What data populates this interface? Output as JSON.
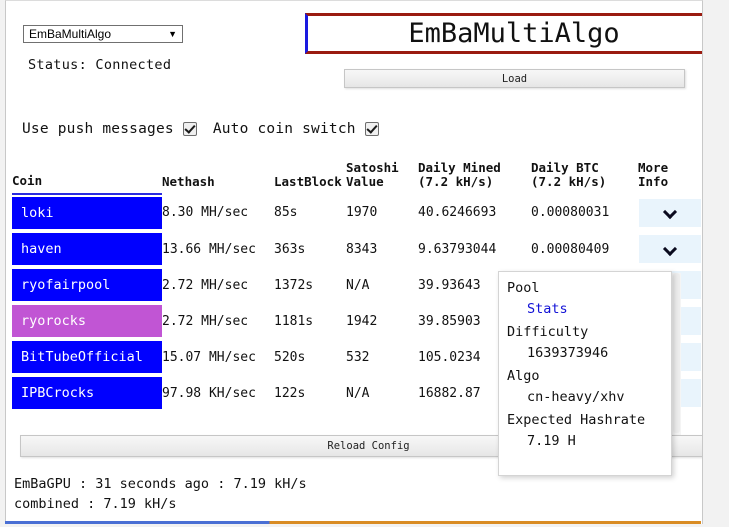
{
  "window": {
    "profile_select": {
      "value": "EmBaMultiAlgo",
      "caret": "▼"
    },
    "status": "Status: Connected",
    "title": "EmBaMultiAlgo",
    "load_button": "Load",
    "reload_button": "Reload Config"
  },
  "options": {
    "push_messages_label": "Use push messages",
    "push_messages_checked": true,
    "auto_switch_label": "Auto coin switch",
    "auto_switch_checked": true
  },
  "table": {
    "headers": {
      "coin": "Coin",
      "nethash": "Nethash",
      "lastblock": "LastBlock",
      "satoshi": "Satoshi\nValue",
      "daily_mined": "Daily Mined\n(7.2 kH/s)",
      "daily_btc": "Daily BTC\n(7.2 kH/s)",
      "more_info": "More Info"
    },
    "rows": [
      {
        "coin": "loki",
        "color": "#0000ff",
        "nethash": "8.30 MH/sec",
        "lastblock": "85s",
        "satoshi": "1970",
        "daily_mined": "40.6246693",
        "daily_btc": "0.00080031",
        "more_icon": "chevron-down-icon"
      },
      {
        "coin": "haven",
        "color": "#0000ff",
        "nethash": "13.66 MH/sec",
        "lastblock": "363s",
        "satoshi": "8343",
        "daily_mined": "9.63793044",
        "daily_btc": "0.00080409",
        "more_icon": "chevron-down-icon"
      },
      {
        "coin": "ryofairpool",
        "color": "#0000ff",
        "nethash": "2.72 MH/sec",
        "lastblock": "1372s",
        "satoshi": "N/A",
        "daily_mined": "39.93643",
        "daily_btc": "",
        "more_icon": "chevron-down-icon"
      },
      {
        "coin": "ryorocks",
        "color": "#c155d4",
        "nethash": "2.72 MH/sec",
        "lastblock": "1181s",
        "satoshi": "1942",
        "daily_mined": "39.85903",
        "daily_btc": "",
        "more_icon": "chevron-down-icon"
      },
      {
        "coin": "BitTubeOfficial",
        "color": "#0000ff",
        "nethash": "15.07 MH/sec",
        "lastblock": "520s",
        "satoshi": "532",
        "daily_mined": "105.0234",
        "daily_btc": "",
        "more_icon": "chevron-down-icon"
      },
      {
        "coin": "IPBCrocks",
        "color": "#0000ff",
        "nethash": "97.98 KH/sec",
        "lastblock": "122s",
        "satoshi": "N/A",
        "daily_mined": "16882.87",
        "daily_btc": "",
        "more_icon": "chevron-down-icon"
      }
    ]
  },
  "popup": {
    "pool_label": "Pool",
    "pool_value": "Stats",
    "difficulty_label": "Difficulty",
    "difficulty_value": "1639373946",
    "algo_label": "Algo",
    "algo_value": "cn-heavy/xhv",
    "hashrate_label": "Expected Hashrate",
    "hashrate_value": "7.19 H"
  },
  "footer": {
    "line1": "EmBaGPU : 31 seconds ago : 7.19 kH/s",
    "line2": "combined : 7.19 kH/s"
  },
  "colors": {
    "title_border_horizontal": "#9a1b10",
    "title_border_vertical": "#1a1ae0",
    "row_default": "#0000ff",
    "row_active": "#c155d4",
    "more_cell_bg": "#e9f4fc",
    "link": "#1212d6",
    "header_rule": "#2a2ae0"
  }
}
